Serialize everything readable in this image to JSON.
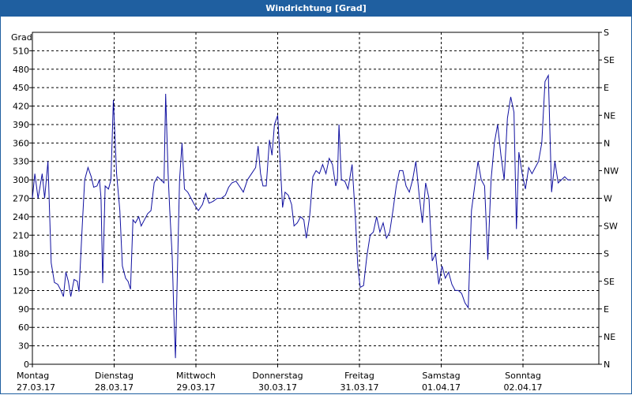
{
  "window": {
    "title": "Windrichtung [Grad]"
  },
  "chart_data": {
    "type": "line",
    "title": "Windrichtung [Grad]",
    "ylabel": "Grad",
    "ylim": [
      0,
      540
    ],
    "y_ticks": [
      0,
      30,
      60,
      90,
      120,
      150,
      180,
      210,
      240,
      270,
      300,
      330,
      360,
      390,
      420,
      450,
      480,
      510
    ],
    "right_ticks": [
      "N",
      "NE",
      "E",
      "SE",
      "S",
      "SW",
      "W",
      "NW",
      "N",
      "NE",
      "E",
      "SE",
      "S"
    ],
    "x_ticks": [
      {
        "day": "Montag",
        "date": "27.03.17"
      },
      {
        "day": "Dienstag",
        "date": "28.03.17"
      },
      {
        "day": "Mittwoch",
        "date": "29.03.17"
      },
      {
        "day": "Donnerstag",
        "date": "30.03.17"
      },
      {
        "day": "Freitag",
        "date": "31.03.17"
      },
      {
        "day": "Samstag",
        "date": "01.04.17"
      },
      {
        "day": "Sonntag",
        "date": "02.04.17"
      }
    ],
    "xlim": [
      0,
      7
    ],
    "grid": true,
    "series": [
      {
        "color": "#1010a0",
        "points": [
          [
            0.0,
            270
          ],
          [
            0.03,
            310
          ],
          [
            0.07,
            270
          ],
          [
            0.12,
            310
          ],
          [
            0.15,
            270
          ],
          [
            0.19,
            330
          ],
          [
            0.23,
            165
          ],
          [
            0.27,
            133
          ],
          [
            0.31,
            130
          ],
          [
            0.35,
            120
          ],
          [
            0.38,
            110
          ],
          [
            0.41,
            150
          ],
          [
            0.44,
            135
          ],
          [
            0.47,
            110
          ],
          [
            0.51,
            138
          ],
          [
            0.55,
            135
          ],
          [
            0.57,
            118
          ],
          [
            0.61,
            225
          ],
          [
            0.64,
            300
          ],
          [
            0.68,
            320
          ],
          [
            0.72,
            305
          ],
          [
            0.75,
            288
          ],
          [
            0.79,
            290
          ],
          [
            0.82,
            300
          ],
          [
            0.84,
            270
          ],
          [
            0.86,
            132
          ],
          [
            0.89,
            290
          ],
          [
            0.93,
            285
          ],
          [
            0.96,
            300
          ],
          [
            0.99,
            430
          ],
          [
            1.03,
            310
          ],
          [
            1.07,
            250
          ],
          [
            1.1,
            160
          ],
          [
            1.14,
            140
          ],
          [
            1.17,
            135
          ],
          [
            1.2,
            122
          ],
          [
            1.23,
            235
          ],
          [
            1.26,
            230
          ],
          [
            1.3,
            240
          ],
          [
            1.33,
            225
          ],
          [
            1.37,
            235
          ],
          [
            1.41,
            245
          ],
          [
            1.45,
            250
          ],
          [
            1.49,
            295
          ],
          [
            1.53,
            305
          ],
          [
            1.57,
            300
          ],
          [
            1.61,
            295
          ],
          [
            1.63,
            440
          ],
          [
            1.66,
            310
          ],
          [
            1.68,
            250
          ],
          [
            1.71,
            175
          ],
          [
            1.73,
            80
          ],
          [
            1.75,
            10
          ],
          [
            1.77,
            130
          ],
          [
            1.8,
            300
          ],
          [
            1.83,
            360
          ],
          [
            1.86,
            285
          ],
          [
            1.9,
            280
          ],
          [
            1.94,
            270
          ],
          [
            1.98,
            260
          ],
          [
            2.03,
            250
          ],
          [
            2.08,
            260
          ],
          [
            2.12,
            278
          ],
          [
            2.16,
            262
          ],
          [
            2.21,
            265
          ],
          [
            2.26,
            270
          ],
          [
            2.31,
            270
          ],
          [
            2.36,
            275
          ],
          [
            2.4,
            288
          ],
          [
            2.44,
            295
          ],
          [
            2.49,
            298
          ],
          [
            2.53,
            290
          ],
          [
            2.58,
            280
          ],
          [
            2.63,
            300
          ],
          [
            2.68,
            310
          ],
          [
            2.73,
            320
          ],
          [
            2.76,
            355
          ],
          [
            2.79,
            310
          ],
          [
            2.82,
            290
          ],
          [
            2.86,
            290
          ],
          [
            2.9,
            365
          ],
          [
            2.93,
            340
          ],
          [
            2.96,
            390
          ],
          [
            3.0,
            405
          ],
          [
            3.03,
            330
          ],
          [
            3.06,
            255
          ],
          [
            3.09,
            280
          ],
          [
            3.13,
            275
          ],
          [
            3.17,
            260
          ],
          [
            3.2,
            225
          ],
          [
            3.24,
            230
          ],
          [
            3.28,
            240
          ],
          [
            3.32,
            235
          ],
          [
            3.35,
            205
          ],
          [
            3.39,
            240
          ],
          [
            3.43,
            305
          ],
          [
            3.47,
            315
          ],
          [
            3.51,
            310
          ],
          [
            3.55,
            325
          ],
          [
            3.59,
            310
          ],
          [
            3.63,
            335
          ],
          [
            3.67,
            325
          ],
          [
            3.71,
            290
          ],
          [
            3.73,
            300
          ],
          [
            3.75,
            390
          ],
          [
            3.78,
            300
          ],
          [
            3.82,
            298
          ],
          [
            3.86,
            285
          ],
          [
            3.91,
            325
          ],
          [
            3.95,
            240
          ],
          [
            3.98,
            160
          ],
          [
            4.01,
            125
          ],
          [
            4.05,
            128
          ],
          [
            4.09,
            175
          ],
          [
            4.13,
            210
          ],
          [
            4.17,
            215
          ],
          [
            4.21,
            240
          ],
          [
            4.25,
            215
          ],
          [
            4.29,
            230
          ],
          [
            4.33,
            205
          ],
          [
            4.37,
            215
          ],
          [
            4.41,
            250
          ],
          [
            4.45,
            290
          ],
          [
            4.49,
            315
          ],
          [
            4.53,
            315
          ],
          [
            4.57,
            290
          ],
          [
            4.61,
            280
          ],
          [
            4.65,
            300
          ],
          [
            4.69,
            330
          ],
          [
            4.73,
            275
          ],
          [
            4.77,
            230
          ],
          [
            4.81,
            295
          ],
          [
            4.85,
            270
          ],
          [
            4.89,
            168
          ],
          [
            4.93,
            180
          ],
          [
            4.97,
            130
          ],
          [
            5.01,
            160
          ],
          [
            5.05,
            140
          ],
          [
            5.09,
            150
          ],
          [
            5.13,
            130
          ],
          [
            5.17,
            120
          ],
          [
            5.21,
            120
          ],
          [
            5.25,
            115
          ],
          [
            5.29,
            100
          ],
          [
            5.33,
            92
          ],
          [
            5.37,
            250
          ],
          [
            5.41,
            290
          ],
          [
            5.45,
            330
          ],
          [
            5.49,
            300
          ],
          [
            5.53,
            290
          ],
          [
            5.57,
            170
          ],
          [
            5.61,
            300
          ],
          [
            5.65,
            360
          ],
          [
            5.69,
            390
          ],
          [
            5.73,
            340
          ],
          [
            5.77,
            300
          ],
          [
            5.81,
            400
          ],
          [
            5.85,
            435
          ],
          [
            5.89,
            410
          ],
          [
            5.92,
            220
          ],
          [
            5.95,
            345
          ],
          [
            5.99,
            310
          ],
          [
            6.03,
            285
          ],
          [
            6.07,
            320
          ],
          [
            6.11,
            310
          ],
          [
            6.15,
            320
          ],
          [
            6.19,
            330
          ],
          [
            6.23,
            360
          ],
          [
            6.27,
            460
          ],
          [
            6.31,
            470
          ],
          [
            6.35,
            280
          ],
          [
            6.39,
            330
          ],
          [
            6.43,
            295
          ],
          [
            6.47,
            300
          ],
          [
            6.51,
            305
          ],
          [
            6.55,
            300
          ],
          [
            6.59,
            300
          ]
        ]
      }
    ]
  }
}
